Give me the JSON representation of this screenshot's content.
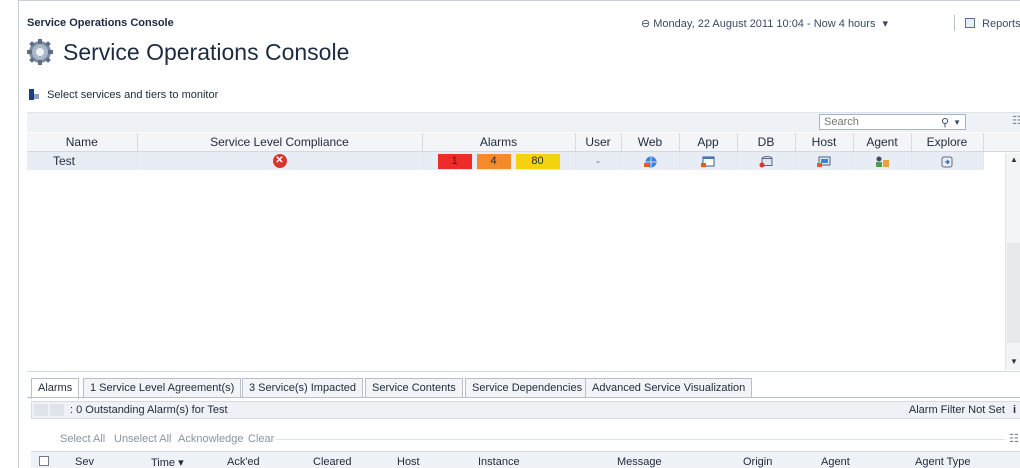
{
  "top_bar": {
    "app_title": "Service Operations Console",
    "time_range": "⊖ Monday, 22 August 2011 10:04 - Now 4 hours",
    "time_range_dropdown": "▾",
    "reports_label": "Reports",
    "reports_dropdown": "▾"
  },
  "page_title": "Service Operations Console",
  "select_link": "Select services and tiers to monitor",
  "search": {
    "placeholder": "Search",
    "value": ""
  },
  "services_table": {
    "columns": [
      "Name",
      "Service Level Compliance",
      "Alarms",
      "User",
      "Web",
      "App",
      "DB",
      "Host",
      "Agent",
      "Explore"
    ],
    "rows": [
      {
        "name": "Test",
        "compliance": "error",
        "alarms": {
          "fatal": "1",
          "critical": "4",
          "warning": "80"
        },
        "user": "-",
        "web": "web-tier-icon",
        "app": "app-tier-icon",
        "db": "db-tier-icon",
        "host": "host-tier-icon",
        "agent": "agent-tier-icon",
        "explore": "explore-icon"
      }
    ]
  },
  "tabs": [
    {
      "label": "Alarms",
      "active": true
    },
    {
      "label": "1 Service Level Agreement(s)",
      "active": false
    },
    {
      "label": "3 Service(s) Impacted",
      "active": false
    },
    {
      "label": "Service Contents",
      "active": false
    },
    {
      "label": "Service Dependencies",
      "active": false
    },
    {
      "label": "Advanced Service Visualization",
      "active": false
    }
  ],
  "alarms_panel": {
    "summary": ": 0 Outstanding Alarm(s) for Test",
    "filter": "Alarm Filter  Not Set",
    "info_icon": "i",
    "actions": [
      "Select All",
      "Unselect All",
      "Acknowledge",
      "Clear"
    ],
    "columns": [
      "Sev",
      "Time ▾",
      "Ack'ed",
      "Cleared",
      "Host",
      "Instance",
      "Message",
      "Origin",
      "Agent",
      "Agent Type"
    ]
  },
  "colors": {
    "fatal": "#ee2b2b",
    "critical": "#f58a2c",
    "warning": "#f5d20f",
    "row_bg": "#e8edf5"
  }
}
